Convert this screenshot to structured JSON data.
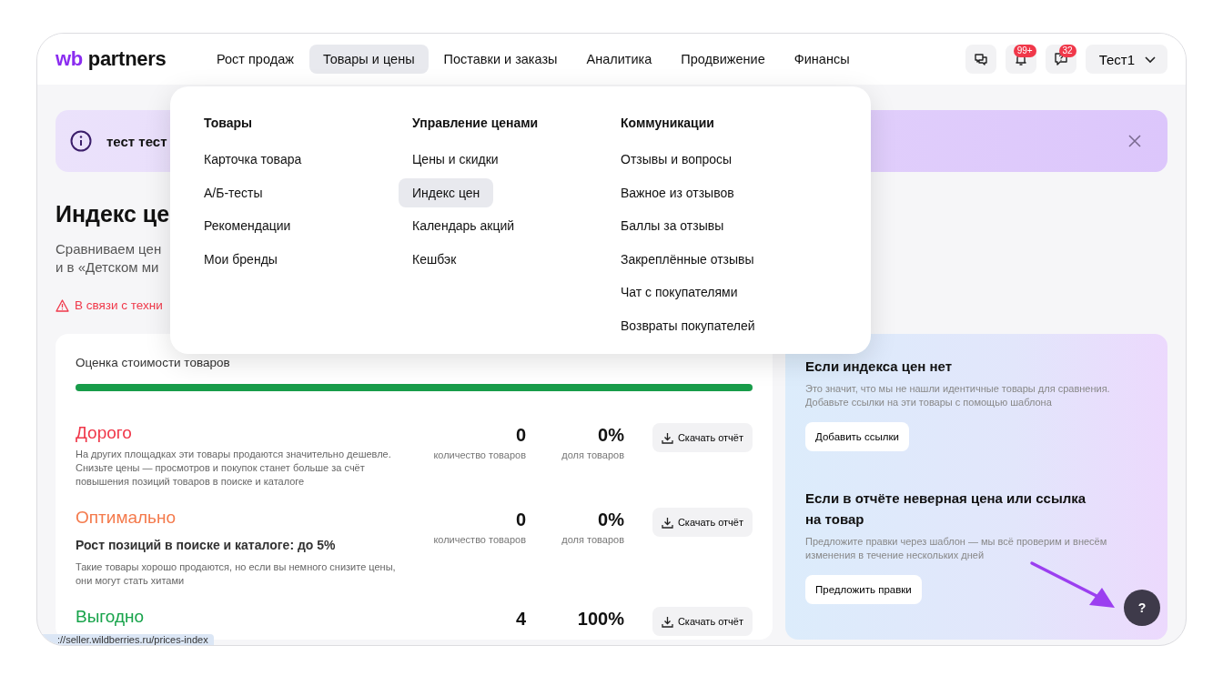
{
  "header": {
    "logo": {
      "mark": "wb",
      "name": "partners"
    },
    "nav": [
      {
        "label": "Рост продаж",
        "selected": false
      },
      {
        "label": "Товары и цены",
        "selected": true
      },
      {
        "label": "Поставки и заказы",
        "selected": false
      },
      {
        "label": "Аналитика",
        "selected": false
      },
      {
        "label": "Продвижение",
        "selected": false
      },
      {
        "label": "Финансы",
        "selected": false
      }
    ],
    "actions": [
      {
        "kind": "chat"
      },
      {
        "kind": "bell",
        "badge": "99+"
      },
      {
        "kind": "question",
        "badge": "32"
      }
    ],
    "user": "Тест1"
  },
  "banner": {
    "text": "тест тест"
  },
  "page": {
    "title": "Индекс це",
    "description": [
      "Сравниваем цен",
      "и в «Детском ми"
    ],
    "warning": "В связи с техни"
  },
  "dropdown": {
    "columns": [
      {
        "title": "Товары",
        "items": [
          {
            "label": "Карточка товара",
            "selected": false
          },
          {
            "label": "А/Б-тесты",
            "selected": false
          },
          {
            "label": "Рекомендации",
            "selected": false
          },
          {
            "label": "Мои бренды",
            "selected": false
          }
        ]
      },
      {
        "title": "Управление ценами",
        "items": [
          {
            "label": "Цены и скидки",
            "selected": false
          },
          {
            "label": "Индекс цен",
            "selected": true
          },
          {
            "label": "Календарь акций",
            "selected": false
          },
          {
            "label": "Кешбэк",
            "selected": false
          }
        ]
      },
      {
        "title": "Коммуникации",
        "items": [
          {
            "label": "Отзывы и вопросы",
            "selected": false
          },
          {
            "label": "Важное из отзывов",
            "selected": false
          },
          {
            "label": "Баллы за отзывы",
            "selected": false
          },
          {
            "label": "Закреплённые отзывы",
            "selected": false
          },
          {
            "label": "Чат с покупателями",
            "selected": false
          },
          {
            "label": "Возвраты покупателей",
            "selected": false
          }
        ]
      }
    ]
  },
  "rating": {
    "title": "Оценка стоимости товаров",
    "level": 1,
    "categories": [
      {
        "title": "Дорого",
        "color": "#f0384a",
        "description": "На других площадках эти товары продаются значительно дешевле. Снизьте цены — просмотров и покупок станет больше за счёт повышения позиций товаров в поиске и каталоге",
        "count": "0",
        "count_label": "количество товаров",
        "share": "0%",
        "share_label": "доля товаров",
        "button": "Скачать отчёт"
      },
      {
        "title": "Оптимально",
        "color": "#f47a4c",
        "subtitle": "Рост позиций в поиске и каталоге: до 5%",
        "description": "Такие товары хорошо продаются, но если вы немного снизите цены, они могут стать хитами",
        "count": "0",
        "count_label": "количество товаров",
        "share": "0%",
        "share_label": "доля товаров",
        "button": "Скачать отчёт"
      },
      {
        "title": "Выгодно",
        "color": "#17a34a",
        "count": "4",
        "share": "100%",
        "button": "Скачать отчёт"
      }
    ]
  },
  "help_panel": {
    "sections": [
      {
        "title": "Если индекса цен нет",
        "text": "Это значит, что мы не нашли идентичные товары для сравнения. Добавьте ссылки на эти товары с помощью шаблона",
        "button": "Добавить ссылки"
      },
      {
        "title": "Если в отчёте неверная цена или ссылка на товар",
        "text": "Предложите правки через шаблон — мы всё проверим и внесём изменения в течение нескольких дней",
        "button": "Предложить правки"
      }
    ]
  },
  "help_button": "?",
  "status_url": "://seller.wildberries.ru/prices-index"
}
